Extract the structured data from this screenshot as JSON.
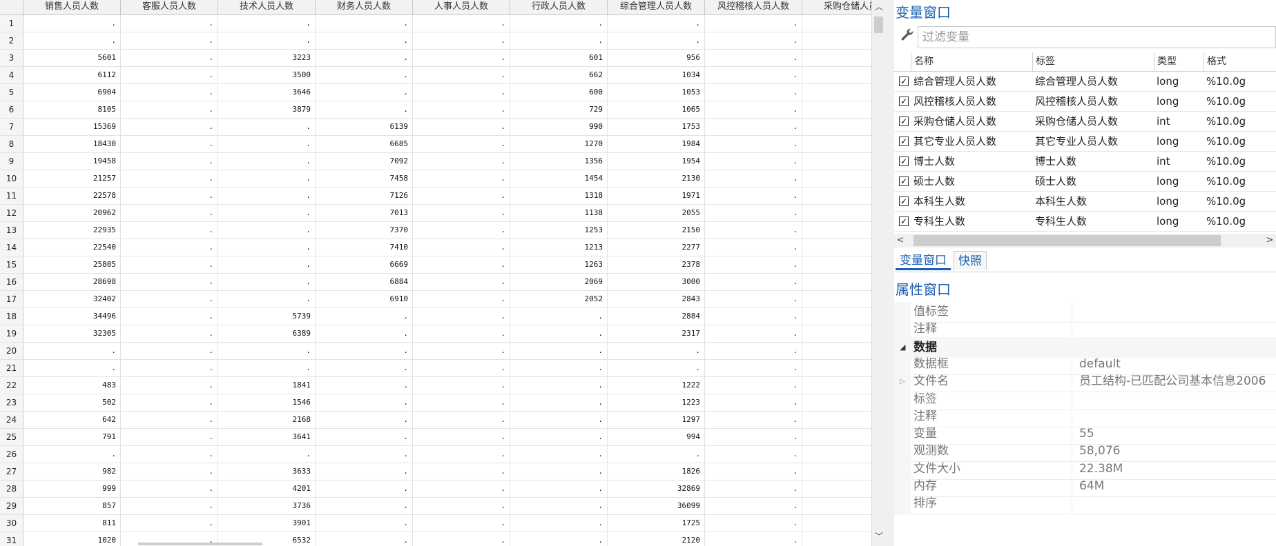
{
  "grid": {
    "columns": [
      "销售人员人数",
      "客服人员人数",
      "技术人员人数",
      "财务人员人数",
      "人事人员人数",
      "行政人员人数",
      "综合管理人员人数",
      "风控稽核人员人数",
      "采购仓储人员"
    ],
    "rows": [
      {
        "n": "1",
        "c": [
          ".",
          ".",
          ".",
          ".",
          ".",
          ".",
          ".",
          ".",
          ""
        ]
      },
      {
        "n": "2",
        "c": [
          ".",
          ".",
          ".",
          ".",
          ".",
          ".",
          ".",
          ".",
          ""
        ]
      },
      {
        "n": "3",
        "c": [
          "5601",
          ".",
          "3223",
          ".",
          ".",
          "601",
          "956",
          ".",
          ""
        ]
      },
      {
        "n": "4",
        "c": [
          "6112",
          ".",
          "3500",
          ".",
          ".",
          "662",
          "1034",
          ".",
          ""
        ]
      },
      {
        "n": "5",
        "c": [
          "6904",
          ".",
          "3646",
          ".",
          ".",
          "600",
          "1053",
          ".",
          ""
        ]
      },
      {
        "n": "6",
        "c": [
          "8105",
          ".",
          "3879",
          ".",
          ".",
          "729",
          "1065",
          ".",
          ""
        ]
      },
      {
        "n": "7",
        "c": [
          "15369",
          ".",
          ".",
          "6139",
          ".",
          "990",
          "1753",
          ".",
          ""
        ]
      },
      {
        "n": "8",
        "c": [
          "18430",
          ".",
          ".",
          "6685",
          ".",
          "1270",
          "1984",
          ".",
          ""
        ]
      },
      {
        "n": "9",
        "c": [
          "19458",
          ".",
          ".",
          "7092",
          ".",
          "1356",
          "1954",
          ".",
          ""
        ]
      },
      {
        "n": "10",
        "c": [
          "21257",
          ".",
          ".",
          "7458",
          ".",
          "1454",
          "2130",
          ".",
          ""
        ]
      },
      {
        "n": "11",
        "c": [
          "22578",
          ".",
          ".",
          "7126",
          ".",
          "1318",
          "1971",
          ".",
          ""
        ]
      },
      {
        "n": "12",
        "c": [
          "20962",
          ".",
          ".",
          "7013",
          ".",
          "1138",
          "2055",
          ".",
          ""
        ]
      },
      {
        "n": "13",
        "c": [
          "22935",
          ".",
          ".",
          "7370",
          ".",
          "1253",
          "2150",
          ".",
          ""
        ]
      },
      {
        "n": "14",
        "c": [
          "22540",
          ".",
          ".",
          "7410",
          ".",
          "1213",
          "2277",
          ".",
          ""
        ]
      },
      {
        "n": "15",
        "c": [
          "25805",
          ".",
          ".",
          "6669",
          ".",
          "1263",
          "2378",
          ".",
          ""
        ]
      },
      {
        "n": "16",
        "c": [
          "28698",
          ".",
          ".",
          "6884",
          ".",
          "2069",
          "3000",
          ".",
          ""
        ]
      },
      {
        "n": "17",
        "c": [
          "32402",
          ".",
          ".",
          "6910",
          ".",
          "2052",
          "2843",
          ".",
          ""
        ]
      },
      {
        "n": "18",
        "c": [
          "34496",
          ".",
          "5739",
          ".",
          ".",
          ".",
          "2884",
          ".",
          ""
        ]
      },
      {
        "n": "19",
        "c": [
          "32305",
          ".",
          "6389",
          ".",
          ".",
          ".",
          "2317",
          ".",
          ""
        ]
      },
      {
        "n": "20",
        "c": [
          ".",
          ".",
          ".",
          ".",
          ".",
          ".",
          ".",
          ".",
          ""
        ]
      },
      {
        "n": "21",
        "c": [
          ".",
          ".",
          ".",
          ".",
          ".",
          ".",
          ".",
          ".",
          ""
        ]
      },
      {
        "n": "22",
        "c": [
          "483",
          ".",
          "1841",
          ".",
          ".",
          ".",
          "1222",
          ".",
          ""
        ]
      },
      {
        "n": "23",
        "c": [
          "502",
          ".",
          "1546",
          ".",
          ".",
          ".",
          "1223",
          ".",
          ""
        ]
      },
      {
        "n": "24",
        "c": [
          "642",
          ".",
          "2168",
          ".",
          ".",
          ".",
          "1297",
          ".",
          ""
        ]
      },
      {
        "n": "25",
        "c": [
          "791",
          ".",
          "3641",
          ".",
          ".",
          ".",
          "994",
          ".",
          ""
        ]
      },
      {
        "n": "26",
        "c": [
          ".",
          ".",
          ".",
          ".",
          ".",
          ".",
          ".",
          ".",
          ""
        ]
      },
      {
        "n": "27",
        "c": [
          "982",
          ".",
          "3633",
          ".",
          ".",
          ".",
          "1826",
          ".",
          ""
        ]
      },
      {
        "n": "28",
        "c": [
          "999",
          ".",
          "4201",
          ".",
          ".",
          ".",
          "32869",
          ".",
          ""
        ]
      },
      {
        "n": "29",
        "c": [
          "857",
          ".",
          "3736",
          ".",
          ".",
          ".",
          "36099",
          ".",
          ""
        ]
      },
      {
        "n": "30",
        "c": [
          "811",
          ".",
          "3901",
          ".",
          ".",
          ".",
          "1725",
          ".",
          ""
        ]
      },
      {
        "n": "31",
        "c": [
          "1020",
          ".",
          "6532",
          ".",
          ".",
          ".",
          "2120",
          ".",
          ""
        ]
      }
    ]
  },
  "scroll": {
    "up_arrow": "︿",
    "down_arrow": "﹀",
    "left_arrow": "<",
    "right_arrow": ">"
  },
  "variables_window": {
    "title": "变量窗口",
    "filter_placeholder": "过滤变量",
    "filter_icon": "wrench-icon",
    "columns": [
      "名称",
      "标签",
      "类型",
      "格式"
    ],
    "rows": [
      {
        "checked": true,
        "name": "综合管理人员人数",
        "label": "综合管理人员人数",
        "type": "long",
        "format": "%10.0g"
      },
      {
        "checked": true,
        "name": "风控稽核人员人数",
        "label": "风控稽核人员人数",
        "type": "long",
        "format": "%10.0g"
      },
      {
        "checked": true,
        "name": "采购仓储人员人数",
        "label": "采购仓储人员人数",
        "type": "int",
        "format": "%10.0g"
      },
      {
        "checked": true,
        "name": "其它专业人员人数",
        "label": "其它专业人员人数",
        "type": "long",
        "format": "%10.0g"
      },
      {
        "checked": true,
        "name": "博士人数",
        "label": "博士人数",
        "type": "int",
        "format": "%10.0g"
      },
      {
        "checked": true,
        "name": "硕士人数",
        "label": "硕士人数",
        "type": "long",
        "format": "%10.0g"
      },
      {
        "checked": true,
        "name": "本科生人数",
        "label": "本科生人数",
        "type": "long",
        "format": "%10.0g"
      },
      {
        "checked": true,
        "name": "专科生人数",
        "label": "专科生人数",
        "type": "long",
        "format": "%10.0g"
      }
    ],
    "check_mark": "✓"
  },
  "tabs": {
    "variables": "变量窗口",
    "snapshots": "快照"
  },
  "properties_window": {
    "title": "属性窗口",
    "top_rows": [
      {
        "label": "值标签",
        "value": ""
      },
      {
        "label": "注释",
        "value": ""
      }
    ],
    "group_title": "数据",
    "group_caret": "◢",
    "expander": "▷",
    "data_rows": [
      {
        "label": "数据框",
        "value": "default"
      },
      {
        "label": "文件名",
        "value": "员工结构-已匹配公司基本信息2006"
      },
      {
        "label": "标签",
        "value": ""
      },
      {
        "label": "注释",
        "value": ""
      },
      {
        "label": "变量",
        "value": "55"
      },
      {
        "label": "观测数",
        "value": "58,076"
      },
      {
        "label": "文件大小",
        "value": "22.38M"
      },
      {
        "label": "内存",
        "value": "64M"
      },
      {
        "label": "排序",
        "value": ""
      }
    ]
  },
  "colors": {
    "accent": "#1a5fb4",
    "grid_line": "#e3e3e3",
    "header_bg": "#f2f2f2"
  }
}
